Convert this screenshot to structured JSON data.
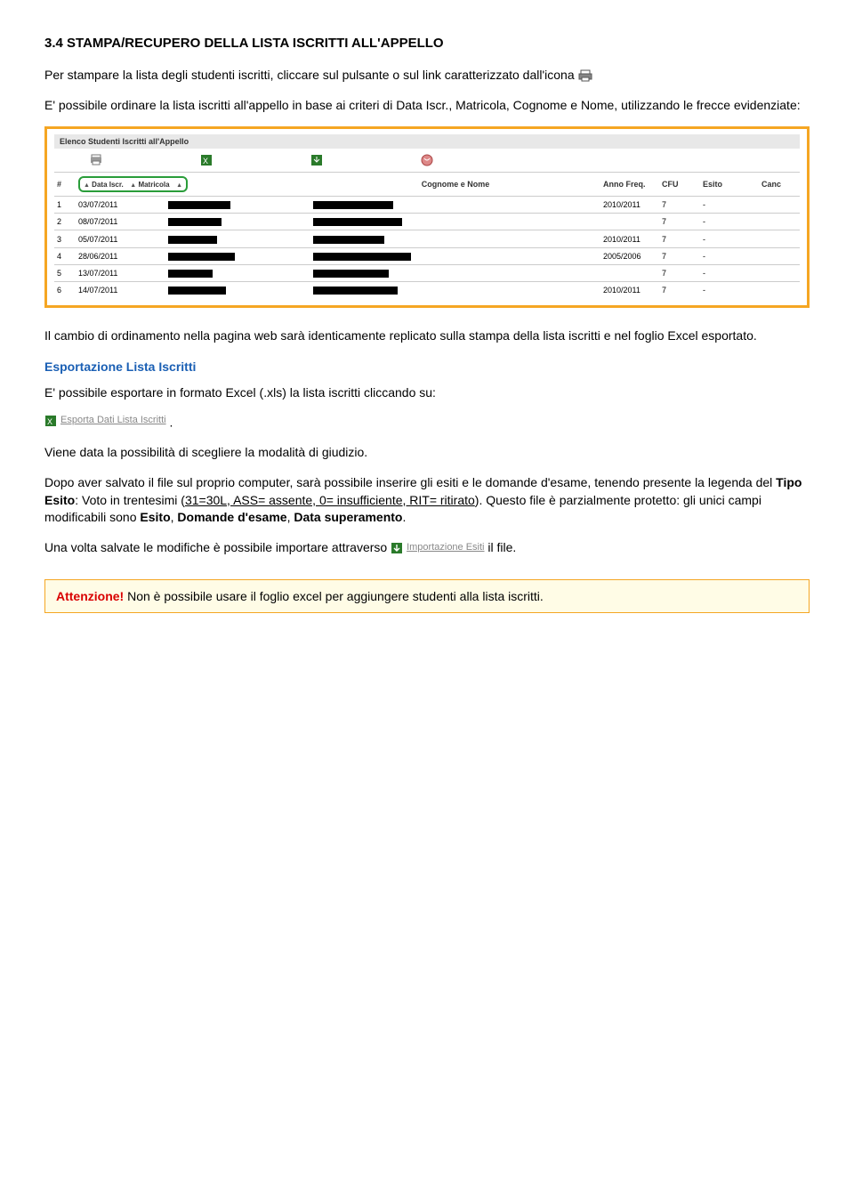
{
  "section": {
    "title": "3.4 STAMPA/RECUPERO DELLA LISTA ISCRITTI ALL'APPELLO",
    "intro_1": "Per stampare la lista degli studenti iscritti, cliccare sul pulsante o sul link caratterizzato dall'icona",
    "intro_2": "E' possibile ordinare la lista iscritti all'appello in base ai criteri di Data Iscr., Matricola, Cognome e Nome, utilizzando le frecce evidenziate:"
  },
  "screenshot": {
    "panel_title": "Elenco Studenti Iscritti all'Appello",
    "header_num": "#",
    "sort_data": "Data Iscr.",
    "sort_matricola": "Matricola",
    "header_cognome": "Cognome e Nome",
    "header_anno": "Anno Freq.",
    "header_cfu": "CFU",
    "header_esito": "Esito",
    "header_canc": "Canc",
    "rows": [
      {
        "n": "1",
        "date": "03/07/2011",
        "anno": "2010/2011",
        "cfu": "7",
        "esito": "-",
        "w1": 70,
        "w2": 90
      },
      {
        "n": "2",
        "date": "08/07/2011",
        "anno": "",
        "cfu": "7",
        "esito": "-",
        "w1": 60,
        "w2": 100
      },
      {
        "n": "3",
        "date": "05/07/2011",
        "anno": "2010/2011",
        "cfu": "7",
        "esito": "-",
        "w1": 55,
        "w2": 80
      },
      {
        "n": "4",
        "date": "28/06/2011",
        "anno": "2005/2006",
        "cfu": "7",
        "esito": "-",
        "w1": 75,
        "w2": 110
      },
      {
        "n": "5",
        "date": "13/07/2011",
        "anno": "",
        "cfu": "7",
        "esito": "-",
        "w1": 50,
        "w2": 85
      },
      {
        "n": "6",
        "date": "14/07/2011",
        "anno": "2010/2011",
        "cfu": "7",
        "esito": "-",
        "w1": 65,
        "w2": 95
      }
    ]
  },
  "afterscreen": "Il cambio di ordinamento nella pagina web sarà identicamente replicato sulla stampa della lista iscritti e nel foglio Excel esportato.",
  "export": {
    "title": "Esportazione Lista Iscritti",
    "line1": "E' possibile esportare in formato Excel (.xls) la lista iscritti cliccando su:",
    "link_label": "Esporta Dati Lista Iscritti",
    "line2": "Viene data la possibilità di scegliere la modalità di giudizio.",
    "line3_a": "Dopo aver salvato il file sul proprio computer, sarà possibile inserire gli esiti e le domande d'esame, tenendo presente la legenda del ",
    "line3_bold": "Tipo Esito",
    "line3_b": ": Voto in trentesimi (",
    "line3_u": "31=30L, ASS= assente, 0= insufficiente, RIT= ritirato",
    "line3_c": "). Questo file è parzialmente protetto: gli unici campi modificabili sono ",
    "line3_bold2": "Esito",
    "line3_d": ", ",
    "line3_bold3": "Domande d'esame",
    "line3_e": ", ",
    "line3_bold4": "Data superamento",
    "line3_f": ".",
    "line4_a": "Una volta salvate le modifiche è possibile importare attraverso",
    "import_label": "Importazione Esiti",
    "line4_b": " il file."
  },
  "warning": {
    "label": "Attenzione!",
    "text": " Non è possibile usare il foglio excel per aggiungere studenti alla lista iscritti."
  }
}
